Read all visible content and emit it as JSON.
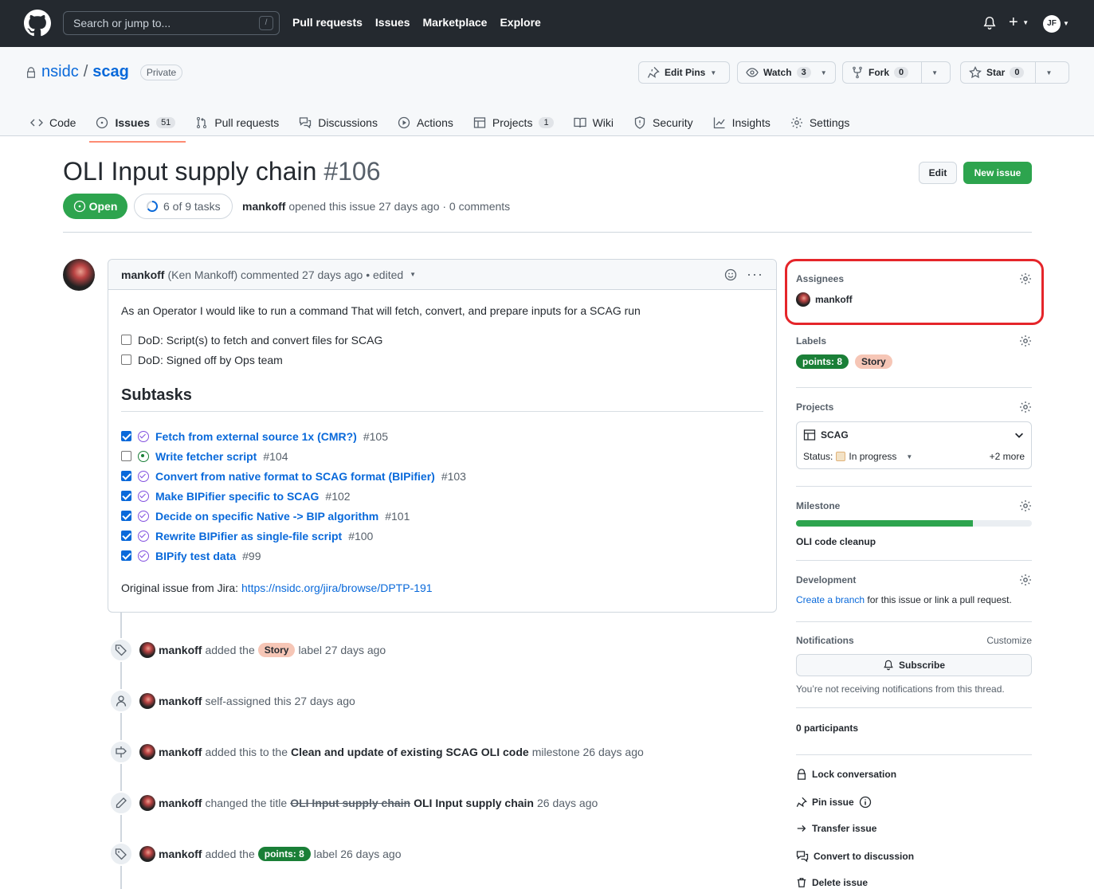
{
  "topbar": {
    "search_placeholder": "Search or jump to...",
    "search_shortcut": "/",
    "nav": [
      "Pull requests",
      "Issues",
      "Marketplace",
      "Explore"
    ],
    "avatar_initials": "JF"
  },
  "repo": {
    "owner": "nsidc",
    "separator": "/",
    "name": "scag",
    "visibility": "Private",
    "edit_pins": "Edit Pins",
    "watch": "Watch",
    "watch_count": "3",
    "fork": "Fork",
    "fork_count": "0",
    "star": "Star",
    "star_count": "0"
  },
  "tabs": [
    {
      "label": "Code",
      "icon": "code-icon"
    },
    {
      "label": "Issues",
      "count": "51",
      "icon": "issue-opened-icon"
    },
    {
      "label": "Pull requests",
      "icon": "git-pull-request-icon"
    },
    {
      "label": "Discussions",
      "icon": "comment-discussion-icon"
    },
    {
      "label": "Actions",
      "icon": "play-icon"
    },
    {
      "label": "Projects",
      "count": "1",
      "icon": "table-icon"
    },
    {
      "label": "Wiki",
      "icon": "book-icon"
    },
    {
      "label": "Security",
      "icon": "shield-icon"
    },
    {
      "label": "Insights",
      "icon": "graph-icon"
    },
    {
      "label": "Settings",
      "icon": "gear-icon"
    }
  ],
  "issue": {
    "title": "OLI Input supply chain",
    "number": "#106",
    "edit": "Edit",
    "new_issue": "New issue",
    "state": "Open",
    "tasks": "6 of 9 tasks",
    "author": "mankoff",
    "meta_rest": "opened this issue 27 days ago · 0 comments"
  },
  "comment": {
    "author": "mankoff",
    "header_rest": "(Ken Mankoff) commented 27 days ago • edited",
    "body": "As an Operator I would like to run a command That will fetch, convert, and prepare inputs for a SCAG run",
    "dod": [
      "DoD: Script(s) to fetch and convert files for SCAG",
      "DoD: Signed off by Ops team"
    ],
    "subtasks_heading": "Subtasks",
    "subtasks": [
      {
        "title": "Fetch from external source 1x (CMR?)",
        "num": "#105",
        "checked": true,
        "state": "closed"
      },
      {
        "title": "Write fetcher script",
        "num": "#104",
        "checked": false,
        "state": "open"
      },
      {
        "title": "Convert from native format to SCAG format (BIPifier)",
        "num": "#103",
        "checked": true,
        "state": "closed"
      },
      {
        "title": "Make BIPifier specific to SCAG",
        "num": "#102",
        "checked": true,
        "state": "closed"
      },
      {
        "title": "Decide on specific Native -> BIP algorithm",
        "num": "#101",
        "checked": true,
        "state": "closed"
      },
      {
        "title": "Rewrite BIPifier as single-file script",
        "num": "#100",
        "checked": true,
        "state": "closed"
      },
      {
        "title": "BIPify test data",
        "num": "#99",
        "checked": true,
        "state": "closed"
      }
    ],
    "jira_prefix": "Original issue from Jira:",
    "jira_link": "https://nsidc.org/jira/browse/DPTP-191"
  },
  "timeline": [
    {
      "actor": "mankoff",
      "pre": "added the",
      "label": "Story",
      "post": "label 27 days ago"
    },
    {
      "actor": "mankoff",
      "text": "self-assigned this 27 days ago"
    },
    {
      "actor": "mankoff",
      "pre": "added this to the",
      "bold": "Clean and update of existing SCAG OLI code",
      "post": "milestone 26 days ago"
    },
    {
      "actor": "mankoff",
      "pre": "changed the title",
      "old": "OLI Input supply chain",
      "new": "OLI Input supply chain",
      "post": "26 days ago"
    },
    {
      "actor": "mankoff",
      "pre": "added the",
      "label": "points: 8",
      "post": "label 26 days ago"
    }
  ],
  "sidebar": {
    "assignees_title": "Assignees",
    "assignee": "mankoff",
    "labels_title": "Labels",
    "labels": [
      "points: 8",
      "Story"
    ],
    "projects_title": "Projects",
    "project_name": "SCAG",
    "status_label": "Status:",
    "status_value": "In progress",
    "more": "+2 more",
    "milestone_title": "Milestone",
    "milestone_name": "OLI code cleanup",
    "milestone_progress": 0.75,
    "development_title": "Development",
    "development_link": "Create a branch",
    "development_rest": "for this issue or link a pull request.",
    "notifications_title": "Notifications",
    "customize": "Customize",
    "subscribe": "Subscribe",
    "notif_note": "You’re not receiving notifications from this thread.",
    "participants": "0 participants",
    "actions": [
      "Lock conversation",
      "Pin issue",
      "Transfer issue",
      "Convert to discussion",
      "Delete issue"
    ]
  },
  "colors": {
    "green": "#2da44e",
    "link": "#0969da",
    "highlight": "#e5252a",
    "story": "#f6c6b6",
    "points": "#1a7f37"
  }
}
